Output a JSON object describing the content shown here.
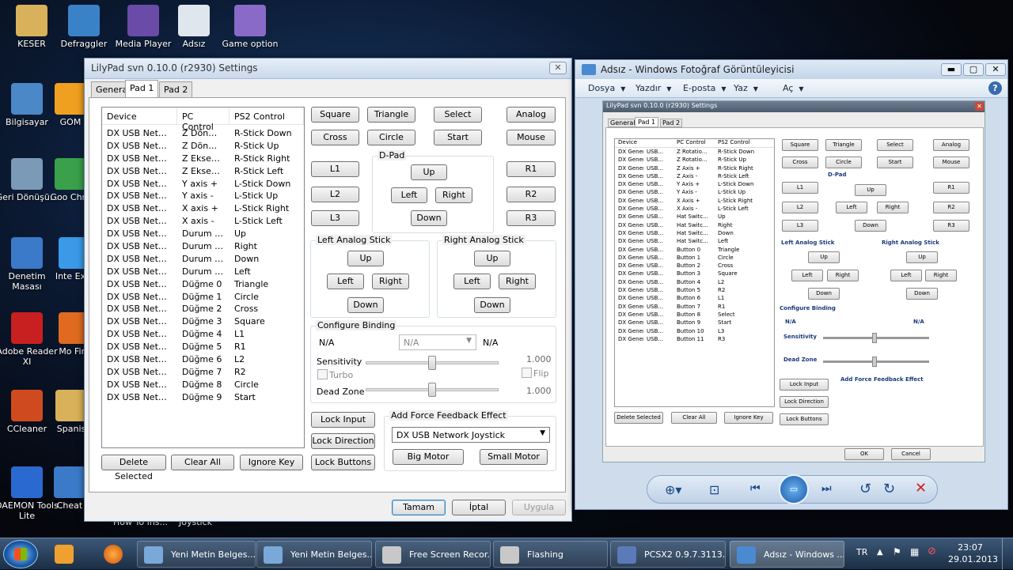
{
  "desktop": {
    "icons": [
      {
        "label": "KESER",
        "color": "#d9b15a"
      },
      {
        "label": "Defraggler",
        "color": "#3a82c8"
      },
      {
        "label": "Media Player",
        "color": "#6a4ba8"
      },
      {
        "label": "Adsız",
        "color": "#dfe6ee"
      },
      {
        "label": "Game option",
        "color": "#8a6ac8"
      },
      {
        "label": "Bilgisayar",
        "color": "#4a88c8"
      },
      {
        "label": "GOM",
        "color": "#f0a020"
      },
      {
        "label": "Geri Dönüşü...",
        "color": "#7a9ab8"
      },
      {
        "label": "Goo Chro",
        "color": "#3aa04a"
      },
      {
        "label": "Denetim Masası",
        "color": "#3a7ac8"
      },
      {
        "label": "Inte Expl",
        "color": "#3a9ae8"
      },
      {
        "label": "Adobe Reader XI",
        "color": "#c82020"
      },
      {
        "label": "Mo Fire",
        "color": "#e06a20"
      },
      {
        "label": "CCleaner",
        "color": "#d04a20"
      },
      {
        "label": "Spanis",
        "color": "#d9b15a"
      },
      {
        "label": "DAEMON Tools Lite",
        "color": "#2a6ad0"
      },
      {
        "label": "Cheat",
        "color": "#3a7ac8"
      }
    ],
    "hidden_labels": [
      "How To Ins...",
      "Joystick"
    ]
  },
  "lilypad": {
    "title": "LilyPad svn 0.10.0 (r2930) Settings",
    "close": "✕",
    "tabs": [
      "General",
      "Pad 1",
      "Pad 2"
    ],
    "list": {
      "headers": [
        "Device",
        "PC Control",
        "PS2 Control"
      ],
      "rows": [
        [
          "DX USB Network ...",
          "Z Dönme...",
          "R-Stick Down"
        ],
        [
          "DX USB Network ...",
          "Z Dönmesi -",
          "R-Stick Up"
        ],
        [
          "DX USB Network ...",
          "Z Ekseni +",
          "R-Stick Right"
        ],
        [
          "DX USB Network ...",
          "Z Ekseni -",
          "R-Stick Left"
        ],
        [
          "DX USB Network ...",
          "Y axis +",
          "L-Stick Down"
        ],
        [
          "DX USB Network ...",
          "Y axis -",
          "L-Stick Up"
        ],
        [
          "DX USB Network ...",
          "X axis +",
          "L-Stick Right"
        ],
        [
          "DX USB Network ...",
          "X axis -",
          "L-Stick Left"
        ],
        [
          "DX USB Network ...",
          "Durum D...",
          "Up"
        ],
        [
          "DX USB Network ...",
          "Durum D...",
          "Right"
        ],
        [
          "DX USB Network ...",
          "Durum D...",
          "Down"
        ],
        [
          "DX USB Network ...",
          "Durum D...",
          "Left"
        ],
        [
          "DX USB Network ...",
          "Düğme 0",
          "Triangle"
        ],
        [
          "DX USB Network ...",
          "Düğme 1",
          "Circle"
        ],
        [
          "DX USB Network ...",
          "Düğme 2",
          "Cross"
        ],
        [
          "DX USB Network ...",
          "Düğme 3",
          "Square"
        ],
        [
          "DX USB Network ...",
          "Düğme 4",
          "L1"
        ],
        [
          "DX USB Network ...",
          "Düğme 5",
          "R1"
        ],
        [
          "DX USB Network ...",
          "Düğme 6",
          "L2"
        ],
        [
          "DX USB Network ...",
          "Düğme 7",
          "R2"
        ],
        [
          "DX USB Network ...",
          "Düğme 8",
          "Circle"
        ],
        [
          "DX USB Network ...",
          "Düğme 9",
          "Start"
        ]
      ]
    },
    "list_buttons": {
      "delete": "Delete Selected",
      "clear": "Clear All",
      "ignore": "Ignore Key"
    },
    "pad_buttons": {
      "square": "Square",
      "triangle": "Triangle",
      "select": "Select",
      "analog": "Analog",
      "cross": "Cross",
      "circle": "Circle",
      "start": "Start",
      "mouse": "Mouse",
      "l1": "L1",
      "l2": "L2",
      "l3": "L3",
      "r1": "R1",
      "r2": "R2",
      "r3": "R3"
    },
    "dpad": {
      "label": "D-Pad",
      "up": "Up",
      "left": "Left",
      "right": "Right",
      "down": "Down"
    },
    "left_stick": {
      "label": "Left Analog Stick",
      "up": "Up",
      "left": "Left",
      "right": "Right",
      "down": "Down"
    },
    "right_stick": {
      "label": "Right Analog Stick",
      "up": "Up",
      "left": "Left",
      "right": "Right",
      "down": "Down"
    },
    "configure": {
      "label": "Configure Binding",
      "na_left": "N/A",
      "combo_value": "N/A",
      "na_right": "N/A",
      "sensitivity_label": "Sensitivity",
      "sensitivity_value": "1.000",
      "sensitivity_level": 0.5,
      "turbo": "Turbo",
      "flip": "Flip",
      "deadzone_label": "Dead Zone",
      "deadzone_value": "1.000",
      "deadzone_level": 0.5
    },
    "lock_buttons": {
      "input": "Lock Input",
      "direction": "Lock Direction",
      "buttons": "Lock Buttons"
    },
    "force_feedback": {
      "label": "Add Force Feedback Effect",
      "device": "DX USB Network Joystick",
      "big": "Big Motor",
      "small": "Small Motor"
    },
    "dialog_buttons": {
      "ok": "Tamam",
      "cancel": "İptal",
      "apply": "Uygula"
    }
  },
  "photo_viewer": {
    "title": "Adsız - Windows Fotoğraf Görüntüleyicisi",
    "menu": [
      "Dosya",
      "Yazdır",
      "E-posta",
      "Yaz",
      "Aç"
    ],
    "help": "?",
    "inner_title": "LilyPad svn 0.10.0 (r2930) Settings",
    "inner_tabs": [
      "General",
      "Pad 1",
      "Pad 2"
    ],
    "inner_headers": [
      "Device",
      "PC Control",
      "PS2 Control"
    ],
    "inner_rows": [
      [
        "DX Generic",
        "USB...",
        "Z Rotatio...",
        "R-Stick Down"
      ],
      [
        "DX Generic",
        "USB...",
        "Z Rotatio...",
        "R-Stick Up"
      ],
      [
        "DX Generic",
        "USB...",
        "Z Axis +",
        "R-Stick Right"
      ],
      [
        "DX Generic",
        "USB...",
        "Z Axis -",
        "R-Stick Left"
      ],
      [
        "DX Generic",
        "USB...",
        "Y Axis +",
        "L-Stick Down"
      ],
      [
        "DX Generic",
        "USB...",
        "Y Axis -",
        "L-Stick Up"
      ],
      [
        "DX Generic",
        "USB...",
        "X Axis +",
        "L-Stick Right"
      ],
      [
        "DX Generic",
        "USB...",
        "X Axis -",
        "L-Stick Left"
      ],
      [
        "DX Generic",
        "USB...",
        "Hat Switc...",
        "Up"
      ],
      [
        "DX Generic",
        "USB...",
        "Hat Switc...",
        "Right"
      ],
      [
        "DX Generic",
        "USB...",
        "Hat Switc...",
        "Down"
      ],
      [
        "DX Generic",
        "USB...",
        "Hat Switc...",
        "Left"
      ],
      [
        "DX Generic",
        "USB...",
        "Button 0",
        "Triangle"
      ],
      [
        "DX Generic",
        "USB...",
        "Button 1",
        "Circle"
      ],
      [
        "DX Generic",
        "USB...",
        "Button 2",
        "Cross"
      ],
      [
        "DX Generic",
        "USB...",
        "Button 3",
        "Square"
      ],
      [
        "DX Generic",
        "USB...",
        "Button 4",
        "L2"
      ],
      [
        "DX Generic",
        "USB...",
        "Button 5",
        "R2"
      ],
      [
        "DX Generic",
        "USB...",
        "Button 6",
        "L1"
      ],
      [
        "DX Generic",
        "USB...",
        "Button 7",
        "R1"
      ],
      [
        "DX Generic",
        "USB...",
        "Button 8",
        "Select"
      ],
      [
        "DX Generic",
        "USB...",
        "Button 9",
        "Start"
      ],
      [
        "DX Generic",
        "USB...",
        "Button 10",
        "L3"
      ],
      [
        "DX Generic",
        "USB...",
        "Button 11",
        "R3"
      ]
    ],
    "inner_buttons": {
      "square": "Square",
      "triangle": "Triangle",
      "select": "Select",
      "analog": "Analog",
      "cross": "Cross",
      "circle": "Circle",
      "start": "Start",
      "mouse": "Mouse",
      "l1": "L1",
      "l2": "L2",
      "l3": "L3",
      "r1": "R1",
      "r2": "R2",
      "r3": "R3",
      "dpad": "D-Pad",
      "up": "Up",
      "left": "Left",
      "right": "Right",
      "down": "Down",
      "left_stick": "Left Analog Stick",
      "right_stick": "Right Analog Stick",
      "configure": "Configure Binding",
      "na": "N/A",
      "sensitivity": "Sensitivity",
      "deadzone": "Dead Zone",
      "lock_input": "Lock Input",
      "lock_direction": "Lock Direction",
      "lock_buttons": "Lock Buttons",
      "force_feedback": "Add Force Feedback Effect",
      "delete": "Delete Selected",
      "clear": "Clear All",
      "ignore": "Ignore Key",
      "ok": "OK",
      "cancel": "Cancel"
    }
  },
  "taskbar": {
    "items": [
      {
        "label": "Yeni Metin Belges...",
        "color": "#7aa8d8"
      },
      {
        "label": "Yeni Metin Belges...",
        "color": "#7aa8d8"
      },
      {
        "label": "Free Screen Recor...",
        "color": "#c8c8c8"
      },
      {
        "label": "Flashing",
        "color": "#c8c8c8"
      },
      {
        "label": "PCSX2  0.9.7.3113...",
        "color": "#5a7ab8"
      },
      {
        "label": "Adsız - Windows ...",
        "color": "#4a8ad0"
      }
    ],
    "lang": "TR",
    "time": "23:07",
    "date": "29.01.2013"
  }
}
